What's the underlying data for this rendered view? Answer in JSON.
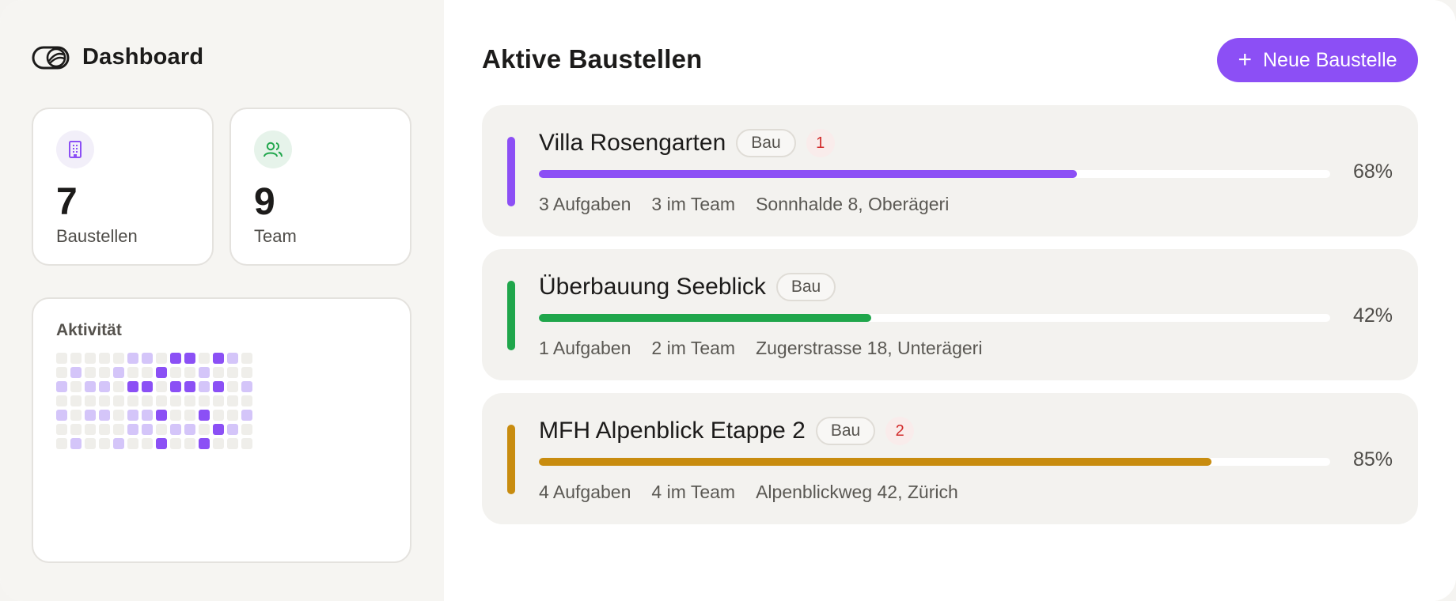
{
  "sidebar": {
    "title": "Dashboard",
    "stats": [
      {
        "value": "7",
        "label": "Baustellen",
        "icon": "building-icon"
      },
      {
        "value": "9",
        "label": "Team",
        "icon": "users-icon"
      }
    ],
    "activity": {
      "title": "Aktivität",
      "heatmap_levels": [
        [
          0,
          0,
          0,
          0,
          0,
          1,
          1,
          0,
          2,
          2,
          0,
          2,
          1,
          0
        ],
        [
          0,
          1,
          0,
          0,
          1,
          0,
          0,
          2,
          0,
          0,
          1,
          0,
          0,
          0
        ],
        [
          1,
          0,
          1,
          1,
          0,
          2,
          2,
          0,
          2,
          2,
          1,
          2,
          0,
          1
        ],
        [
          0,
          0,
          0,
          0,
          0,
          0,
          0,
          0,
          0,
          0,
          0,
          0,
          0,
          0
        ],
        [
          1,
          0,
          1,
          1,
          0,
          1,
          1,
          2,
          0,
          0,
          2,
          0,
          0,
          1
        ],
        [
          0,
          0,
          0,
          0,
          0,
          1,
          1,
          0,
          1,
          1,
          0,
          2,
          1,
          0
        ],
        [
          0,
          1,
          0,
          0,
          1,
          0,
          0,
          2,
          0,
          0,
          2,
          0,
          0,
          0
        ]
      ]
    }
  },
  "main": {
    "title": "Aktive Baustellen",
    "new_button_label": "Neue Baustelle",
    "projects": [
      {
        "name": "Villa Rosengarten",
        "badge": "Bau",
        "alerts": "1",
        "progress": 68,
        "progress_label": "68%",
        "tasks": "3 Aufgaben",
        "team": "3 im Team",
        "address": "Sonnhalde 8, Oberägeri",
        "color": "#8c4ff5"
      },
      {
        "name": "Überbauung Seeblick",
        "badge": "Bau",
        "alerts": "",
        "progress": 42,
        "progress_label": "42%",
        "tasks": "1 Aufgaben",
        "team": "2 im Team",
        "address": "Zugerstrasse 18, Unterägeri",
        "color": "#1fa64b"
      },
      {
        "name": "MFH Alpenblick Etappe 2",
        "badge": "Bau",
        "alerts": "2",
        "progress": 85,
        "progress_label": "85%",
        "tasks": "4 Aufgaben",
        "team": "4 im Team",
        "address": "Alpenblickweg 42, Zürich",
        "color": "#c88c0f"
      }
    ]
  },
  "colors": {
    "accent": "#8c4ff5",
    "heat_low": "#d4c5f9",
    "heat_high": "#8b50f5",
    "heat_empty": "#efeeea",
    "alert_text": "#d22b2b"
  }
}
